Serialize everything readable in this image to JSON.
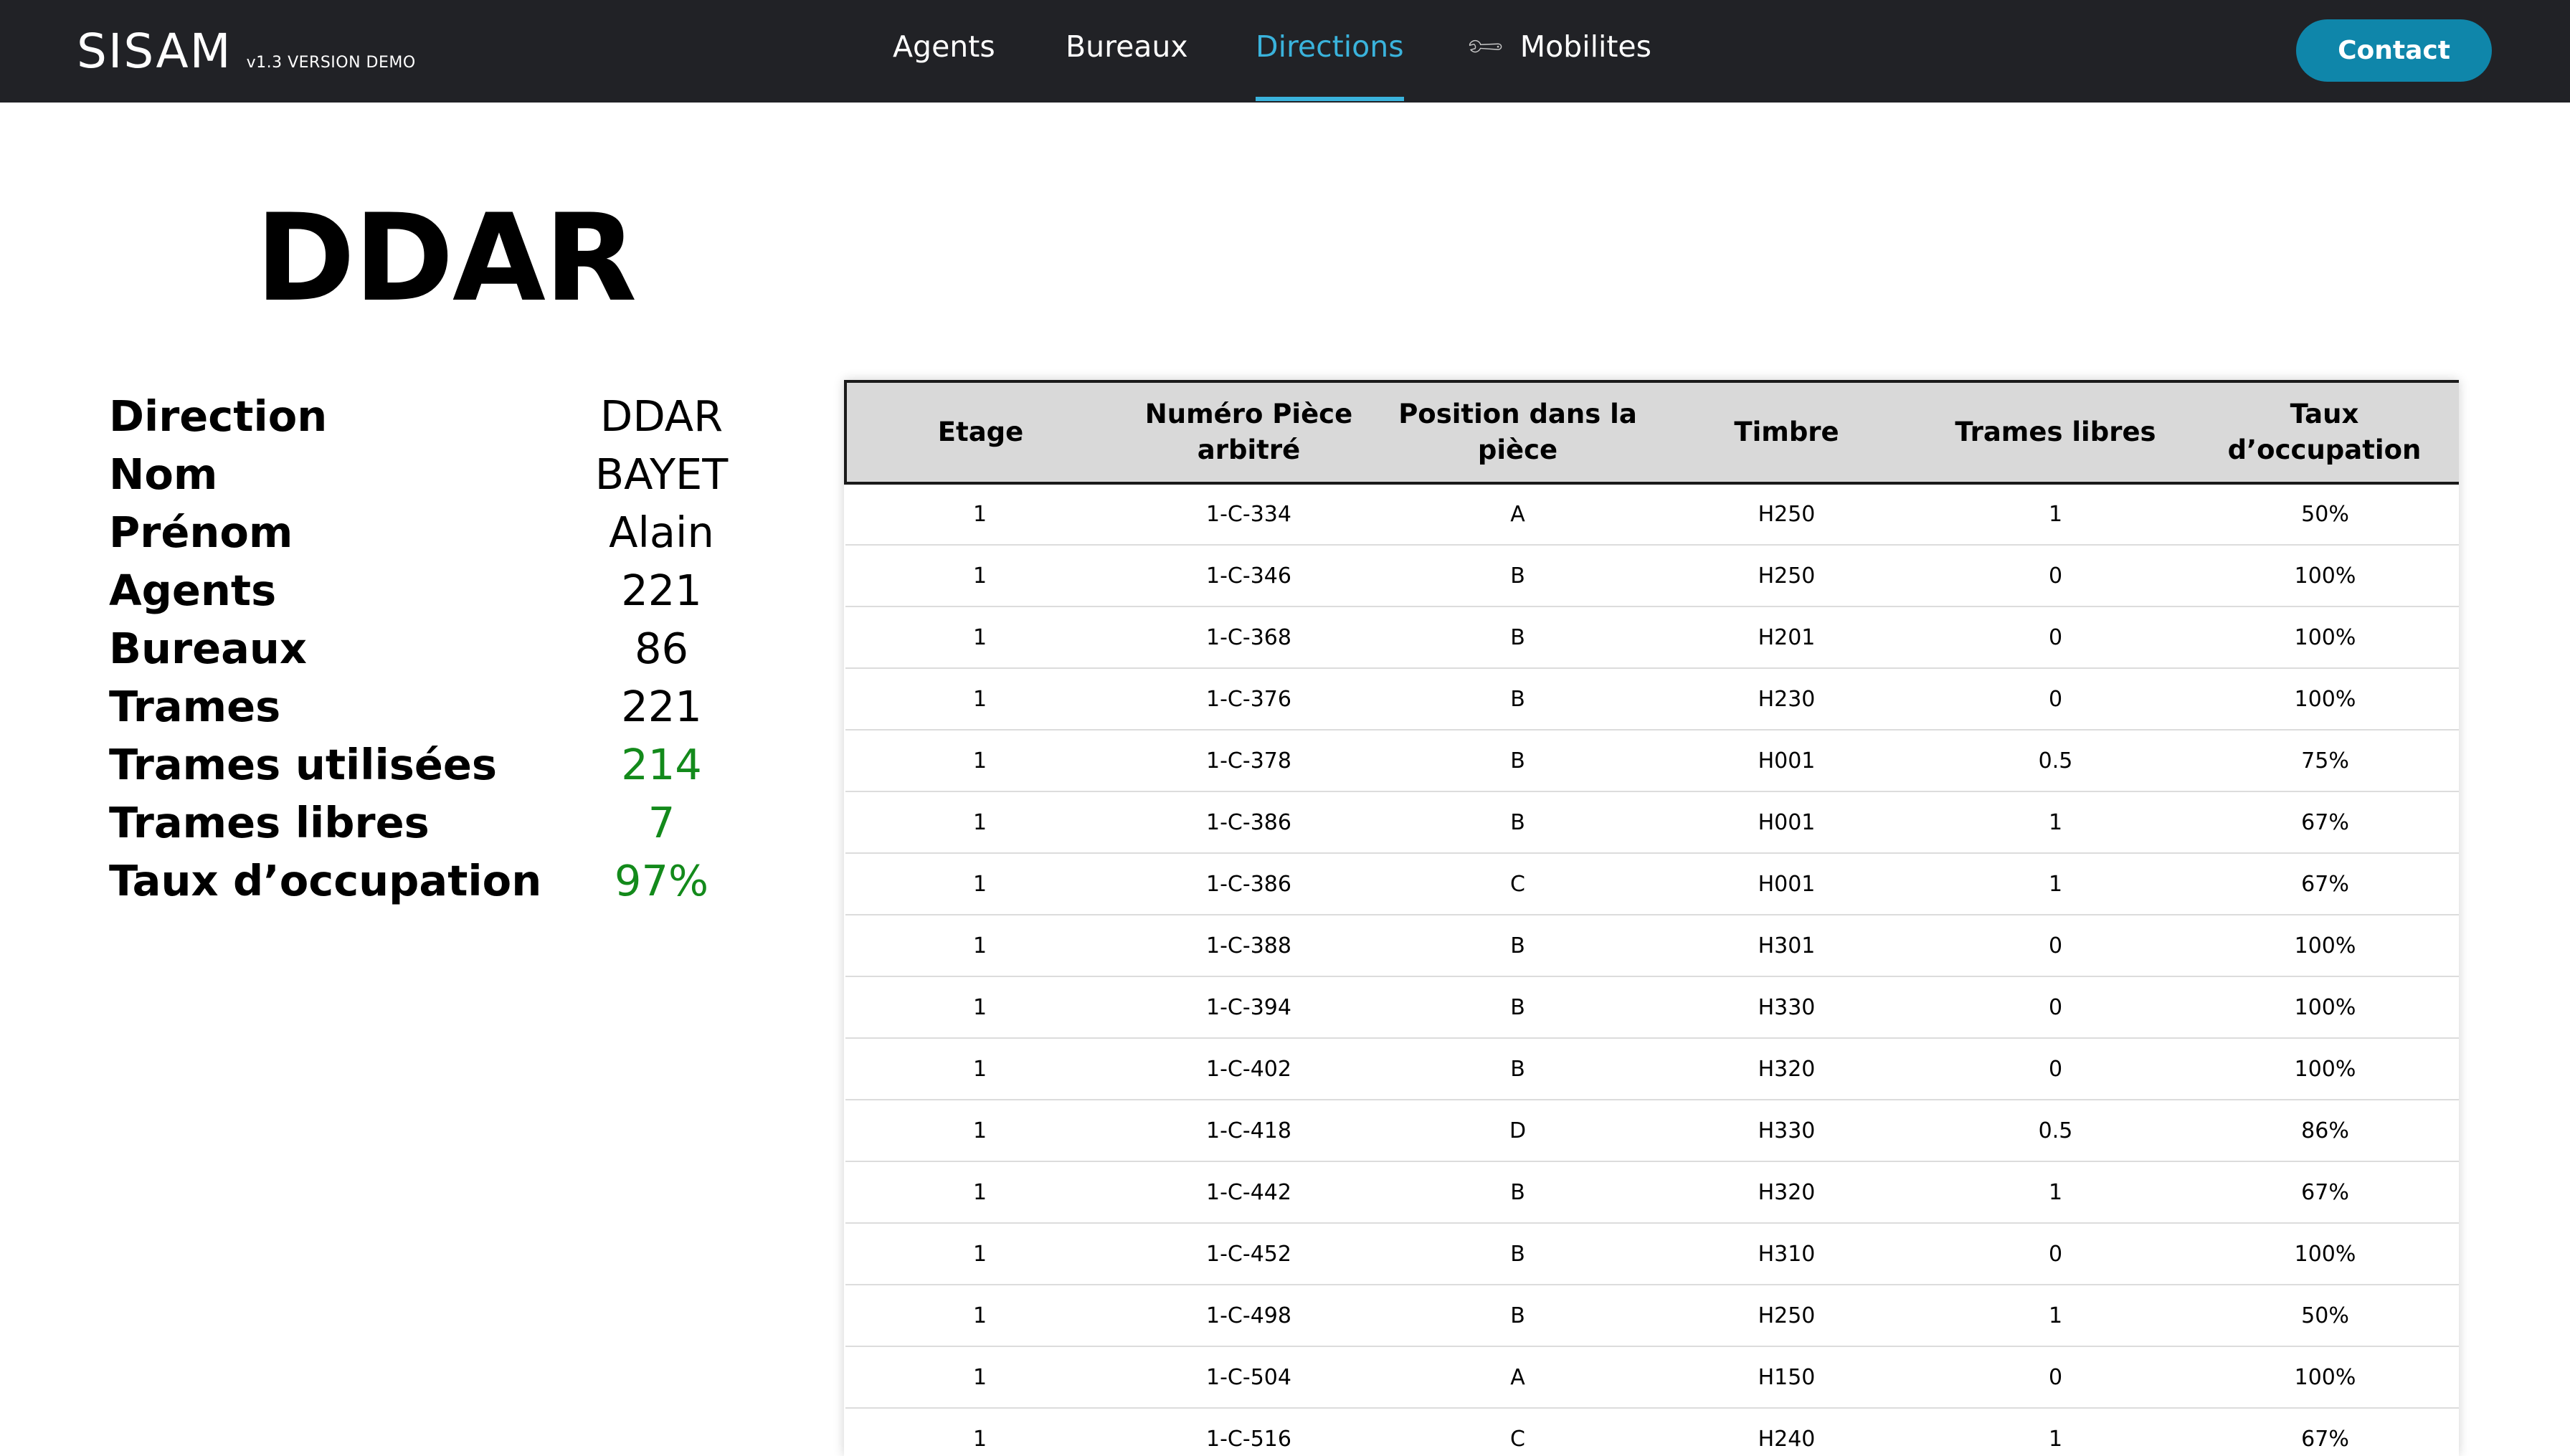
{
  "brand": {
    "name": "SISAM",
    "version": "v1.3 VERSION DEMO"
  },
  "nav": {
    "agents": "Agents",
    "bureaux": "Bureaux",
    "directions": "Directions",
    "mobilites": "Mobilites",
    "mobilites_icon": "wrench-icon",
    "contact": "Contact"
  },
  "page": {
    "title": "DDAR"
  },
  "info": [
    {
      "label": "Direction",
      "value": "DDAR"
    },
    {
      "label": "Nom",
      "value": "BAYET"
    },
    {
      "label": "Prénom",
      "value": "Alain"
    },
    {
      "label": "Agents",
      "value": "221"
    },
    {
      "label": "Bureaux",
      "value": "86"
    },
    {
      "label": "Trames",
      "value": "221"
    },
    {
      "label": "Trames utilisées",
      "value": "214"
    },
    {
      "label": "Trames libres",
      "value": "7"
    },
    {
      "label": "Taux d’occupation",
      "value": "97%"
    }
  ],
  "colors": {
    "nav_bg": "#212226",
    "accent": "#3ab3dc",
    "contact_bg": "#0f86aa",
    "highlight_value": "#138a1b"
  },
  "table": {
    "headers": [
      "Etage",
      "Numéro Pièce arbitré",
      "Position dans la pièce",
      "Timbre",
      "Trames libres",
      "Taux d’occupation"
    ],
    "rows": [
      [
        "1",
        "1-C-334",
        "A",
        "H250",
        "1",
        "50%"
      ],
      [
        "1",
        "1-C-346",
        "B",
        "H250",
        "0",
        "100%"
      ],
      [
        "1",
        "1-C-368",
        "B",
        "H201",
        "0",
        "100%"
      ],
      [
        "1",
        "1-C-376",
        "B",
        "H230",
        "0",
        "100%"
      ],
      [
        "1",
        "1-C-378",
        "B",
        "H001",
        "0.5",
        "75%"
      ],
      [
        "1",
        "1-C-386",
        "B",
        "H001",
        "1",
        "67%"
      ],
      [
        "1",
        "1-C-386",
        "C",
        "H001",
        "1",
        "67%"
      ],
      [
        "1",
        "1-C-388",
        "B",
        "H301",
        "0",
        "100%"
      ],
      [
        "1",
        "1-C-394",
        "B",
        "H330",
        "0",
        "100%"
      ],
      [
        "1",
        "1-C-402",
        "B",
        "H320",
        "0",
        "100%"
      ],
      [
        "1",
        "1-C-418",
        "D",
        "H330",
        "0.5",
        "86%"
      ],
      [
        "1",
        "1-C-442",
        "B",
        "H320",
        "1",
        "67%"
      ],
      [
        "1",
        "1-C-452",
        "B",
        "H310",
        "0",
        "100%"
      ],
      [
        "1",
        "1-C-498",
        "B",
        "H250",
        "1",
        "50%"
      ],
      [
        "1",
        "1-C-504",
        "A",
        "H150",
        "0",
        "100%"
      ],
      [
        "1",
        "1-C-516",
        "C",
        "H240",
        "1",
        "67%"
      ]
    ]
  }
}
